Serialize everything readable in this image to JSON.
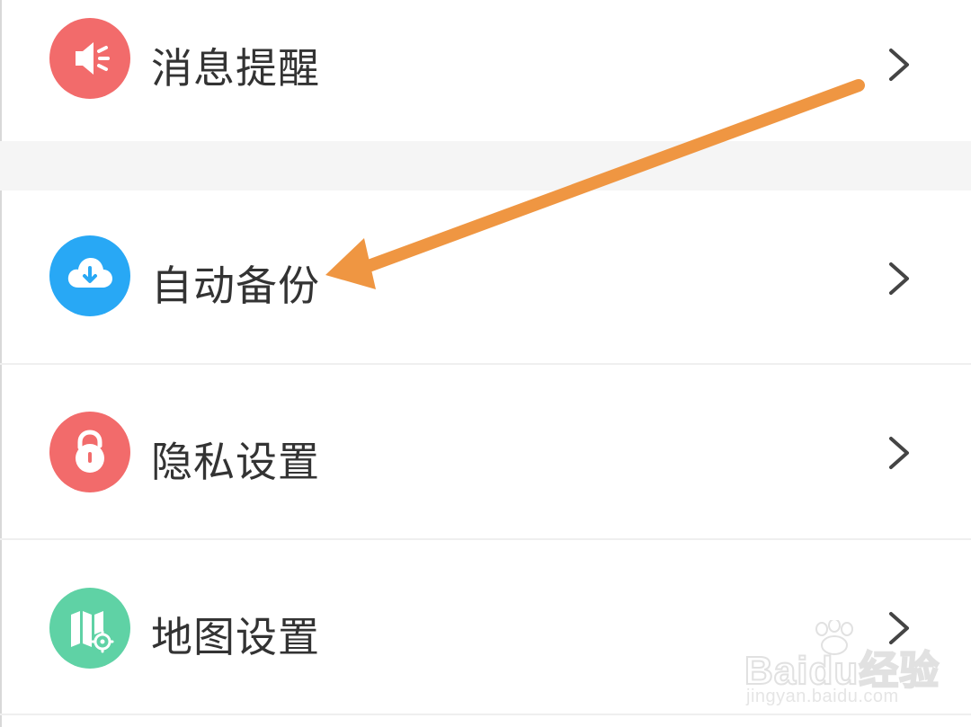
{
  "settings": {
    "items": [
      {
        "label": "消息提醒",
        "icon": "speaker-icon",
        "color": "#f26b6b"
      },
      {
        "label": "自动备份",
        "icon": "cloud-download-icon",
        "color": "#28a8f5"
      },
      {
        "label": "隐私设置",
        "icon": "lock-icon",
        "color": "#f26b6b"
      },
      {
        "label": "地图设置",
        "icon": "map-settings-icon",
        "color": "#5fd2a5"
      }
    ]
  },
  "annotation": {
    "arrow_color": "#ef9642",
    "points_to": "自动备份"
  },
  "watermark": {
    "brand": "Baidu经验",
    "url": "jingyan.baidu.com"
  }
}
